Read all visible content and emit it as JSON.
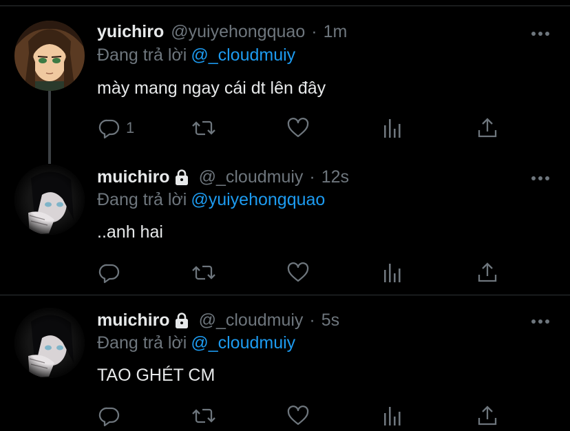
{
  "tweets": [
    {
      "display_name": "yuichiro",
      "handle": "@yuiyehongquao",
      "separator": "·",
      "time": "1m",
      "locked": false,
      "reply_prefix": "Đang trả lời",
      "reply_to": "@_cloudmuiy",
      "text": "mày mang ngay cái dt lên đây",
      "reply_count": "1",
      "thread_continues": true
    },
    {
      "display_name": "muichiro",
      "handle": "@_cloudmuiy",
      "separator": "·",
      "time": "12s",
      "locked": true,
      "reply_prefix": "Đang trả lời",
      "reply_to": "@yuiyehongquao",
      "text": "..anh hai",
      "reply_count": "",
      "thread_continues": false
    },
    {
      "display_name": "muichiro",
      "handle": "@_cloudmuiy",
      "separator": "·",
      "time": "5s",
      "locked": true,
      "reply_prefix": "Đang trả lời",
      "reply_to": "@_cloudmuiy",
      "text": "TAO GHÉT CM",
      "reply_count": "",
      "thread_continues": false
    }
  ],
  "icons": {
    "reply": "reply-icon",
    "retweet": "retweet-icon",
    "like": "heart-icon",
    "stats": "bar-chart-icon",
    "share": "share-icon",
    "more": "more-options-icon",
    "protected": "lock-icon"
  },
  "colors": {
    "background": "#000000",
    "text": "#e7e9ea",
    "muted": "#6e767d",
    "link": "#1d9bf0",
    "divider": "#2f3336"
  }
}
